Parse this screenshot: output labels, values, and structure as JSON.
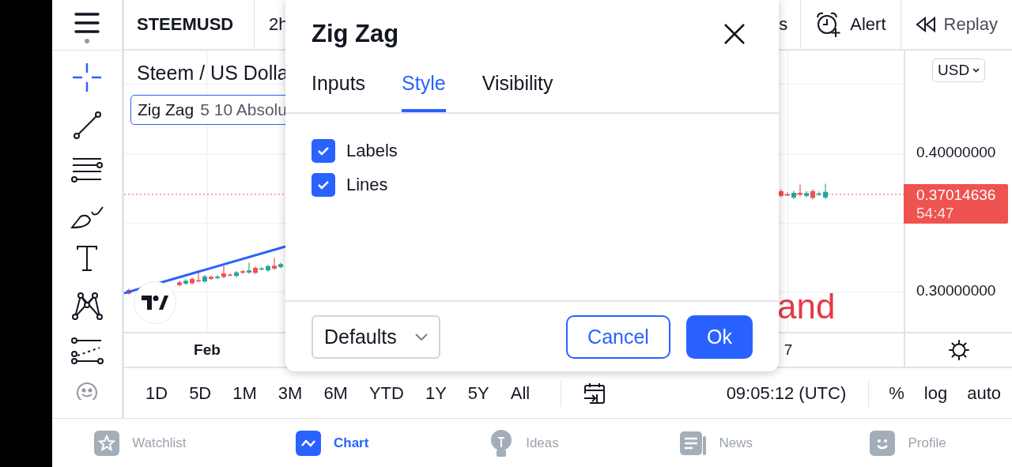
{
  "top_bar": {
    "symbol": "STEEMUSD",
    "interval": "2h",
    "cut_item": "s",
    "alert": "Alert",
    "replay": "Replay"
  },
  "chart": {
    "title": "Steem / US Dolla",
    "legend": {
      "name": "Zig Zag",
      "params": "5 10 Absolu"
    },
    "overlay_text": "and",
    "currency": "USD",
    "price_labels": [
      "0.40000000",
      "0.30000000"
    ],
    "last_price": {
      "price": "0.37014636",
      "countdown": "54:47"
    },
    "time_labels": [
      "Feb",
      "7"
    ]
  },
  "range_bar": {
    "ranges": [
      "1D",
      "5D",
      "1M",
      "3M",
      "6M",
      "YTD",
      "1Y",
      "5Y",
      "All"
    ],
    "time": "09:05:12 (UTC)",
    "scale_options": [
      "%",
      "log",
      "auto"
    ]
  },
  "bottom_nav": [
    {
      "label": "Watchlist",
      "selected": false
    },
    {
      "label": "Chart",
      "selected": true
    },
    {
      "label": "Ideas",
      "selected": false
    },
    {
      "label": "News",
      "selected": false
    },
    {
      "label": "Profile",
      "selected": false
    }
  ],
  "dialog": {
    "title": "Zig Zag",
    "tabs": [
      {
        "label": "Inputs",
        "selected": false
      },
      {
        "label": "Style",
        "selected": true
      },
      {
        "label": "Visibility",
        "selected": false
      }
    ],
    "options": [
      {
        "label": "Labels",
        "checked": true
      },
      {
        "label": "Lines",
        "checked": true
      }
    ],
    "defaults": "Defaults",
    "cancel": "Cancel",
    "ok": "Ok"
  }
}
